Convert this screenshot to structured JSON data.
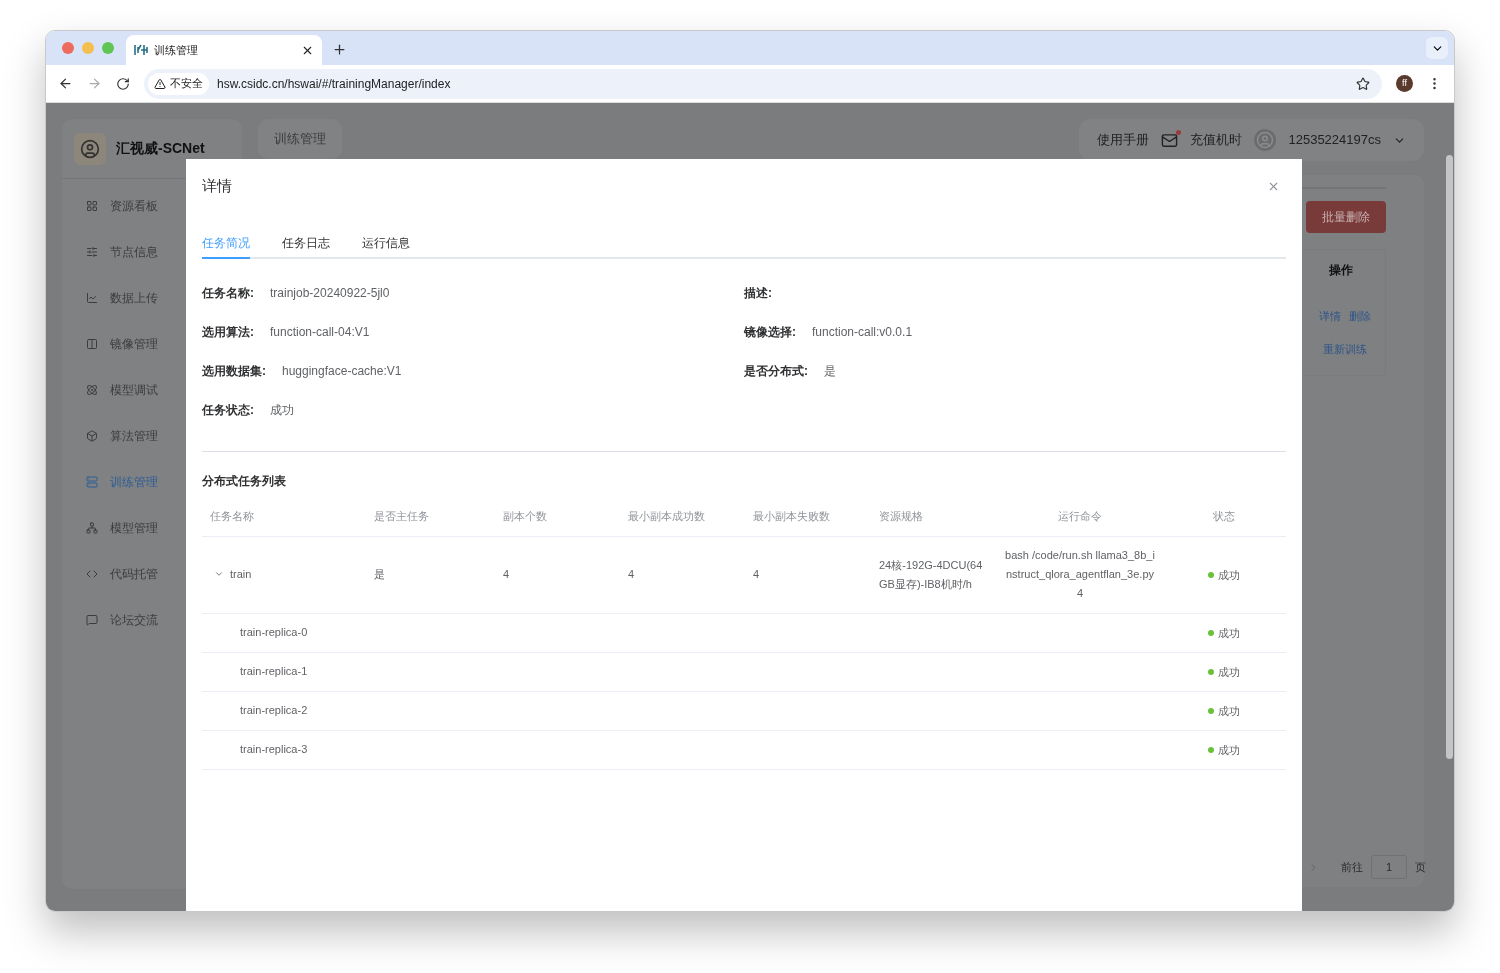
{
  "browser": {
    "tab_title": "训练管理",
    "security": "不安全",
    "url": "hsw.csidc.cn/hswai/#/trainingManager/index",
    "profile": "ff"
  },
  "app": {
    "logo_text": "汇视威-SCNet",
    "header_tab": "训练管理",
    "manual": "使用手册",
    "recharge": "充值机时",
    "mail_unread": true,
    "user": "12535224197cs",
    "sidebar": [
      {
        "label": "资源看板",
        "selected": false
      },
      {
        "label": "节点信息",
        "selected": false
      },
      {
        "label": "数据上传",
        "selected": false
      },
      {
        "label": "镜像管理",
        "selected": false
      },
      {
        "label": "模型调试",
        "selected": false
      },
      {
        "label": "算法管理",
        "selected": false
      },
      {
        "label": "训练管理",
        "selected": true
      },
      {
        "label": "模型管理",
        "selected": false
      },
      {
        "label": "代码托管",
        "selected": false
      },
      {
        "label": "论坛交流",
        "selected": false
      }
    ],
    "batch_delete": "批量删除",
    "ops_header": "操作",
    "row_actions": [
      "详情",
      "删除",
      "重新训练"
    ],
    "pagination": {
      "goto": "前往",
      "page": "1",
      "unit": "页"
    }
  },
  "dialog": {
    "title": "详情",
    "tabs": [
      {
        "label": "任务简况",
        "selected": true
      },
      {
        "label": "任务日志",
        "selected": false
      },
      {
        "label": "运行信息",
        "selected": false
      }
    ],
    "fields": [
      {
        "label": "任务名称:",
        "value": "trainjob-20240922-5jl0"
      },
      {
        "label": "描述:"
      },
      {
        "label": "选用算法:",
        "value": "function-call-04:V1"
      },
      {
        "label": "镜像选择:",
        "value": "function-call:v0.0.1"
      },
      {
        "label": "选用数据集:",
        "value": "huggingface-cache:V1"
      },
      {
        "label": "是否分布式:",
        "value": "是"
      },
      {
        "label": "任务状态:",
        "value": "成功"
      }
    ],
    "section_title": "分布式任务列表",
    "columns": [
      "任务名称",
      "是否主任务",
      "副本个数",
      "最小副本成功数",
      "最小副本失败数",
      "资源规格",
      "运行命令",
      "状态"
    ],
    "rows": [
      {
        "name": "train",
        "expanded": true,
        "main": "是",
        "replicas": "4",
        "min_success": "4",
        "min_fail": "4",
        "resource": "24核-192G-4DCU(64GB显存)-IB8机时/h",
        "command": "bash /code/run.sh llama3_8b_instruct_qlora_agentflan_3e.py 4",
        "status": "成功",
        "color": "#67c23a",
        "children": [
          {
            "name": "train-replica-0",
            "status": "成功",
            "color": "#67c23a"
          },
          {
            "name": "train-replica-1",
            "status": "成功",
            "color": "#67c23a"
          },
          {
            "name": "train-replica-2",
            "status": "成功",
            "color": "#67c23a"
          },
          {
            "name": "train-replica-3",
            "status": "成功",
            "color": "#67c23a"
          }
        ]
      }
    ]
  }
}
